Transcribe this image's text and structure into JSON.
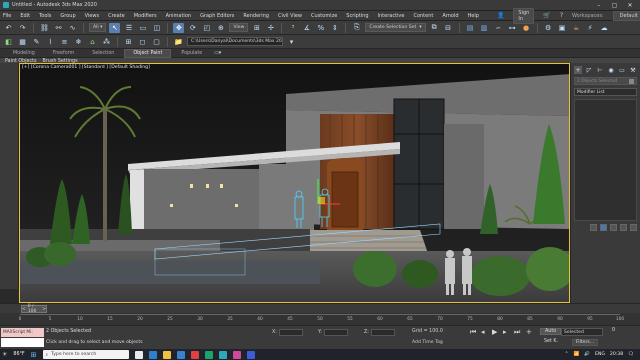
{
  "window": {
    "title": "Untitled - Autodesk 3ds Max 2020"
  },
  "menu": [
    "File",
    "Edit",
    "Tools",
    "Group",
    "Views",
    "Create",
    "Modifiers",
    "Animation",
    "Graph Editors",
    "Rendering",
    "Civil View",
    "Customize",
    "Scripting",
    "Interactive",
    "Content",
    "Arnold",
    "Help"
  ],
  "account": {
    "signin": "Sign In",
    "workspaces_label": "Workspaces:",
    "workspace": "Default"
  },
  "toolbar": {
    "view_dropdown": "View",
    "selection_set": "Create Selection Set",
    "project_path": "C:\\Users\\Danyal\\Documents\\3ds Max 2020"
  },
  "ribbon": {
    "tabs": [
      "Modeling",
      "Freeform",
      "Selection",
      "Object Paint",
      "Populate"
    ],
    "active_tab": "Object Paint",
    "subtabs": [
      "Paint Objects",
      "Brush Settings"
    ]
  },
  "viewport": {
    "label": "[+] [Corona Camera001 ] [Standard ] [Default Shading]"
  },
  "command_panel": {
    "object_name": "2 Objects Selected",
    "modifier_list": "Modifier List"
  },
  "timeline": {
    "current": "0 / 100",
    "ticks": [
      "0",
      "5",
      "10",
      "15",
      "20",
      "25",
      "30",
      "35",
      "40",
      "45",
      "50",
      "55",
      "60",
      "65",
      "70",
      "75",
      "80",
      "85",
      "90",
      "95",
      "100"
    ]
  },
  "status": {
    "maxscript": "MAXScript Mi:",
    "selection": "2 Objects Selected",
    "prompt": "Click and drag to select and move objects",
    "x_label": "X:",
    "y_label": "Y:",
    "z_label": "Z:",
    "grid": "Grid = 100.0",
    "add_time_tag": "Add Time Tag",
    "auto": "Auto",
    "set_key": "Set K.",
    "selected": "Selected",
    "filters": "Filters...",
    "frame": "0"
  },
  "taskbar": {
    "temperature": "86°F",
    "search_placeholder": "Type here to search",
    "lang": "ENG",
    "time": "20:38"
  }
}
